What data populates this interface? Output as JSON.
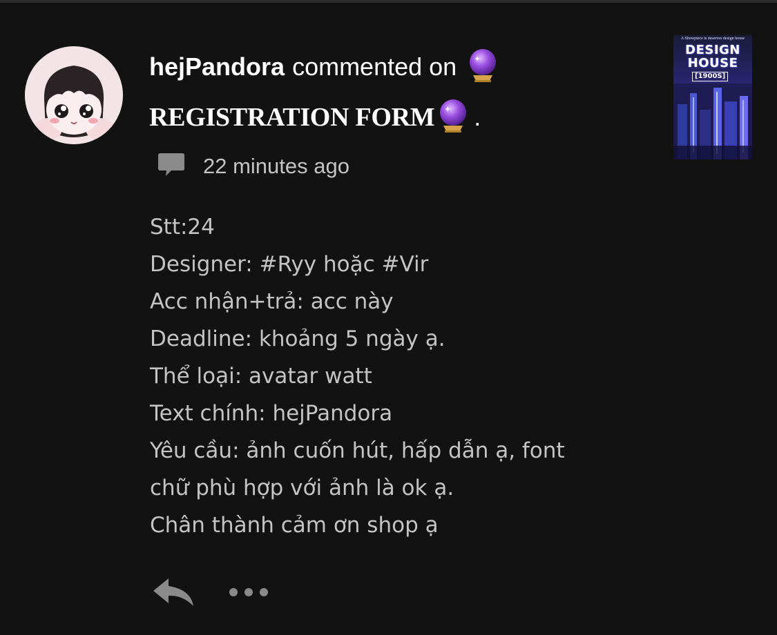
{
  "comment": {
    "username": "hejPandora",
    "action": "commented on",
    "story_title": "REGISTRATION FORM",
    "title_suffix": ".",
    "timestamp": "22 minutes ago",
    "body_lines": [
      "Stt:24",
      "Designer: #Ryy hoặc #Vir",
      "Acc nhận+trả: acc này",
      "Deadline: khoảng 5 ngày ạ.",
      "Thể loại: avatar watt",
      "Text chính: hejPandora",
      "Yêu cầu: ảnh cuốn hút, hấp dẫn ạ, font",
      "chữ phù hợp với ảnh là ok ạ.",
      "Chân thành cảm ơn shop ạ"
    ]
  },
  "book_cover": {
    "tagline": "A Showpiece is deserves design house",
    "title_line1": "DESIGN",
    "title_line2": "HOUSE",
    "year_tag": "[1900S]"
  },
  "icons": {
    "avatar": "avatar-chibi-girl",
    "orb": "crystal-ball-icon",
    "comment": "speech-bubble-icon",
    "reply": "reply-arrow-icon",
    "more": "ellipsis-icon"
  },
  "colors": {
    "background": "#121212",
    "primary_text": "#ffffff",
    "secondary_text": "#c4c4c4",
    "icon_gray": "#8a8a8a",
    "orb_purple": "#8a3fd1"
  }
}
